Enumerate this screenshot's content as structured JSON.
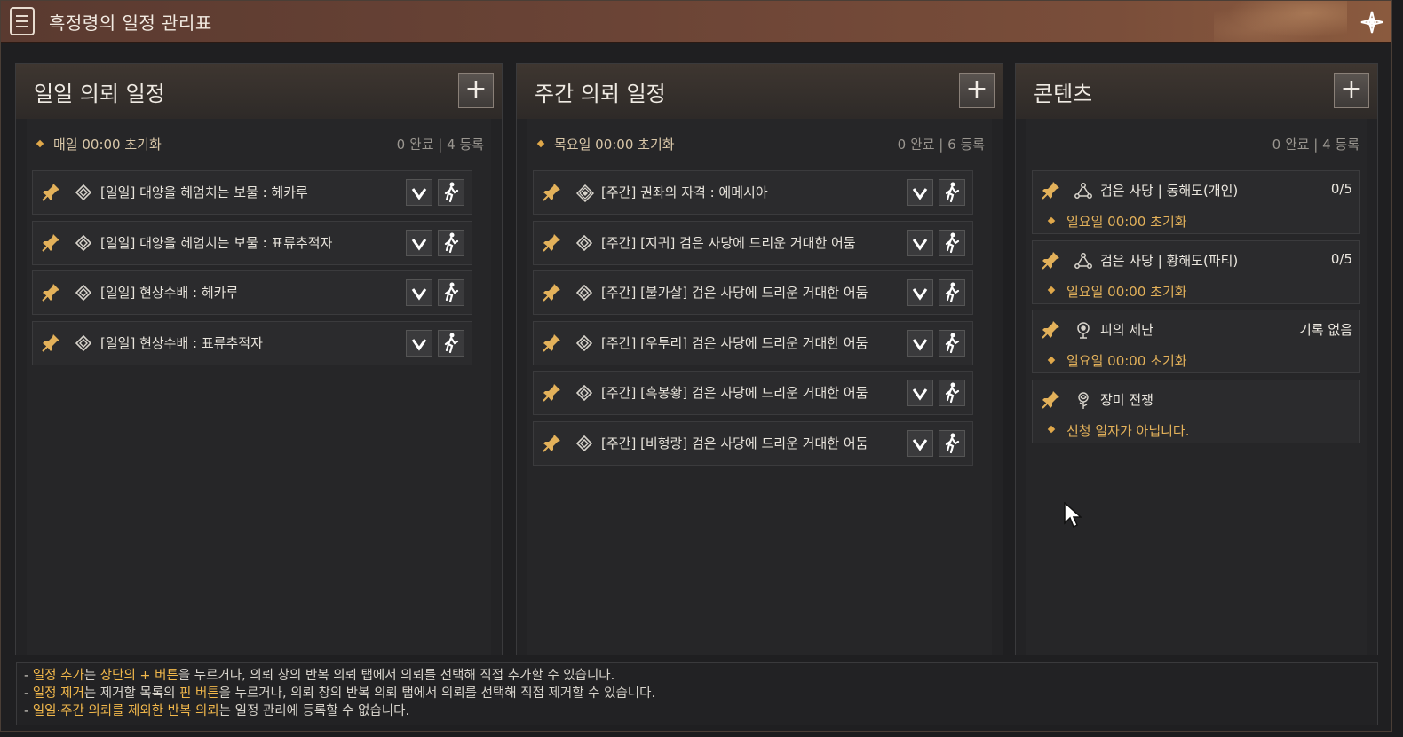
{
  "window": {
    "title": "흑정령의 일정 관리표"
  },
  "daily": {
    "title": "일일 의뢰 일정",
    "add_label": "+",
    "reset": "매일 00:00 초기화",
    "count": "0 완료 | 4 등록",
    "items": [
      "[일일] 대양을 헤엄치는 보물 : 헤카루",
      "[일일] 대양을 헤엄치는 보물 : 표류추적자",
      "[일일] 현상수배 : 헤카루",
      "[일일] 현상수배 : 표류추적자"
    ]
  },
  "weekly": {
    "title": "주간 의뢰 일정",
    "add_label": "+",
    "reset": "목요일 00:00 초기화",
    "count": "0 완료 | 6 등록",
    "items": [
      "[주간] 권좌의 자격 : 에메시아",
      "[주간] [지귀] 검은 사당에 드리운 거대한 어둠",
      "[주간] [불가살] 검은 사당에 드리운 거대한 어둠",
      "[주간] [우투리] 검은 사당에 드리운 거대한 어둠",
      "[주간] [흑봉황] 검은 사당에 드리운 거대한 어둠",
      "[주간] [비형랑] 검은 사당에 드리운 거대한 어둠"
    ]
  },
  "contents": {
    "title": "콘텐츠",
    "add_label": "+",
    "count": "0 완료 | 4 등록",
    "items": [
      {
        "name": "검은 사당 | 동해도(개인)",
        "value": "0/5",
        "sub": "일요일 00:00 초기화",
        "icon": "triangle-nodes-icon"
      },
      {
        "name": "검은 사당 | 황해도(파티)",
        "value": "0/5",
        "sub": "일요일 00:00 초기화",
        "icon": "triangle-nodes-icon"
      },
      {
        "name": "피의 제단",
        "value": "기록 없음",
        "sub": "일요일 00:00 초기화",
        "icon": "blood-altar-icon"
      },
      {
        "name": "장미 전쟁",
        "value": "",
        "sub": "신청 일자가 아닙니다.",
        "icon": "rose-icon"
      }
    ]
  },
  "notes": {
    "line1": {
      "p1": "- ",
      "h1": "일정 추가",
      "p2": "는 ",
      "h2": "상단의 + 버튼",
      "p3": "을 누르거나, 의뢰 창의 반복 의뢰 탭에서 의뢰를 선택해 직접 추가할 수 있습니다."
    },
    "line2": {
      "p1": "- ",
      "h1": "일정 제거",
      "p2": "는 제거할 목록의 ",
      "h2": "핀 버튼",
      "p3": "을 누르거나, 의뢰 창의 반복 의뢰 탭에서 의뢰를 선택해 직접 제거할 수 있습니다."
    },
    "line3": {
      "p1": "- ",
      "h1": "일일·주간 의뢰를 제외한 반복 의뢰",
      "p2": "는 일정 관리에 등록할 수 없습니다."
    }
  },
  "colors": {
    "accent": "#f2b84b",
    "titlebar": "#6b4436",
    "panel": "#232325"
  }
}
